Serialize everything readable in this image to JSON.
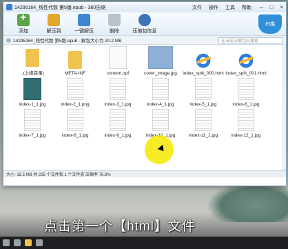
{
  "window": {
    "title": "14295164_线性代数 第5版.epub - 360压缩",
    "menus": [
      "文件",
      "操作",
      "工具",
      "帮助"
    ],
    "controls": {
      "minimize": "–",
      "maximize": "□",
      "close": "×"
    }
  },
  "toolbar": {
    "buttons": [
      "添加",
      "解压到",
      "一键解压",
      "删除",
      "压缩包信息"
    ],
    "shield_label": "扫描"
  },
  "address": {
    "path": "14295164_线性代数 第5版.epub - 解包大小为 20.2 MB",
    "search_placeholder": "在当前压缩包内搜索"
  },
  "files": [
    {
      "name": "..(上级目录)",
      "type": "folder"
    },
    {
      "name": "META-INF",
      "type": "folder"
    },
    {
      "name": "content.opf",
      "type": "file"
    },
    {
      "name": "cover_image.jpg",
      "type": "cover"
    },
    {
      "name": "index_split_000.html",
      "type": "html"
    },
    {
      "name": "index_split_001.html",
      "type": "html"
    },
    {
      "name": "index-1_1.jpg",
      "type": "teal"
    },
    {
      "name": "index-2_1.png",
      "type": "page"
    },
    {
      "name": "index-3_1.jpg",
      "type": "page"
    },
    {
      "name": "index-4_1.jpg",
      "type": "page"
    },
    {
      "name": "index-5_1.jpg",
      "type": "page"
    },
    {
      "name": "index-6_1.jpg",
      "type": "page"
    },
    {
      "name": "index-7_1.jpg",
      "type": "page"
    },
    {
      "name": "index-8_1.jpg",
      "type": "page"
    },
    {
      "name": "index-9_1.jpg",
      "type": "page"
    },
    {
      "name": "index-10_1.jpg",
      "type": "page"
    },
    {
      "name": "index-11_1.jpg",
      "type": "page"
    },
    {
      "name": "index-12_1.jpg",
      "type": "page"
    }
  ],
  "status": "大小: 15.5 MB 共 235 个文件和 1 个文件夹 压缩率 76.8%",
  "subtitle": "点击第一个【html】文件",
  "colors": {
    "highlight": "#f6e800",
    "shield": "#2f8fd8"
  }
}
